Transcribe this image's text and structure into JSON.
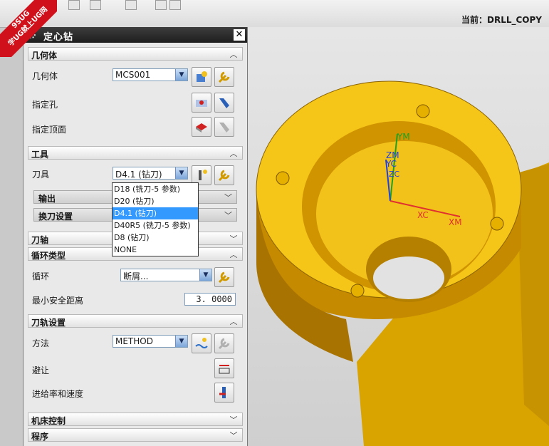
{
  "watermark": {
    "line1": "9SUG",
    "line2": "学UG就上UG网"
  },
  "topbar": {
    "current_label": "当前：DRLL_COPY"
  },
  "dialog": {
    "title": "定心钻",
    "close_glyph": "✕",
    "geometry_section": {
      "title": "几何体"
    },
    "geometry_label": "几何体",
    "geometry_value": "MCS001",
    "specify_hole_label": "指定孔",
    "specify_top_label": "指定顶面",
    "tool_section": {
      "title": "工具"
    },
    "tool_label": "刀具",
    "tool_value": "D4.1 (钻刀)",
    "output_label": "输出",
    "tool_change_label": "换刀设置",
    "axis_section": {
      "title": "刀轴"
    },
    "cycle_section": {
      "title": "循环类型"
    },
    "cycle_label": "循环",
    "cycle_value": "断屑...",
    "min_clearance_label": "最小安全距离",
    "min_clearance_value": "3. 0000",
    "path_section": {
      "title": "刀轨设置"
    },
    "method_label": "方法",
    "method_value": "METHOD",
    "avoid_label": "避让",
    "feeds_label": "进给率和速度",
    "machine_section": {
      "title": "机床控制"
    },
    "program_section": {
      "title": "程序"
    }
  },
  "tool_dropdown": {
    "options": [
      "D18 (铣刀-5 参数)",
      "D20 (钻刀)",
      "D4.1 (钻刀)",
      "D40R5 (铣刀-5 参数)",
      "D8 (钻刀)",
      "NONE"
    ],
    "selected_index": 2
  },
  "csys_labels": {
    "ym": "YM",
    "zm": "ZM",
    "yc": "YC",
    "zc": "ZC",
    "xc": "XC",
    "xm": "XM"
  },
  "colors": {
    "part": "#f5c518",
    "part_dark": "#b07d00",
    "xm_axis": "#e03030",
    "ym_axis": "#20a020",
    "zm_axis": "#2040e0"
  }
}
